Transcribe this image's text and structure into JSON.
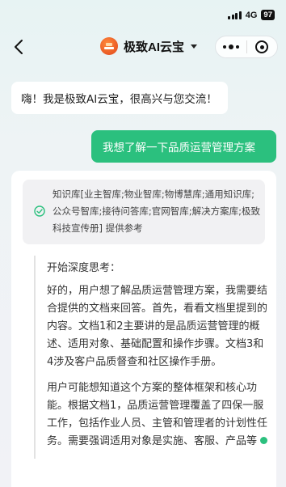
{
  "status_bar": {
    "network": "4G",
    "battery": "97"
  },
  "header": {
    "title": "极致AI云宝",
    "logo_text": "极致"
  },
  "chat": {
    "ai_greeting": "嗨！我是极致AI云宝，很高兴与您交流！",
    "user_message": "我想了解一下品质运营管理方案"
  },
  "answer": {
    "kb_reference": "知识库[业主智库;物业智库;物博慧库;通用知识库;公众号智库;接待问答库;官网智库;解决方案库;极致科技宣传册] 提供参考",
    "thinking_title": "开始深度思考：",
    "thinking_paragraphs": [
      "好的，用户想了解品质运营管理方案，我需要结合提供的文档来回答。首先，看看文档里提到的内容。文档1和2主要讲的是品质运营管理的概述、适用对象、基础配置和操作步骤。文档3和4涉及客户品质督查和社区操作手册。",
      "用户可能想知道这个方案的整体框架和核心功能。根据文档1，品质运营管理覆盖了四保一服工作，包括作业人员、主管和管理者的计划性任务。需要强调适用对象是实施、客服、产品等"
    ]
  },
  "colors": {
    "accent_green": "#2bc07e",
    "logo_orange": "#e0451a"
  }
}
